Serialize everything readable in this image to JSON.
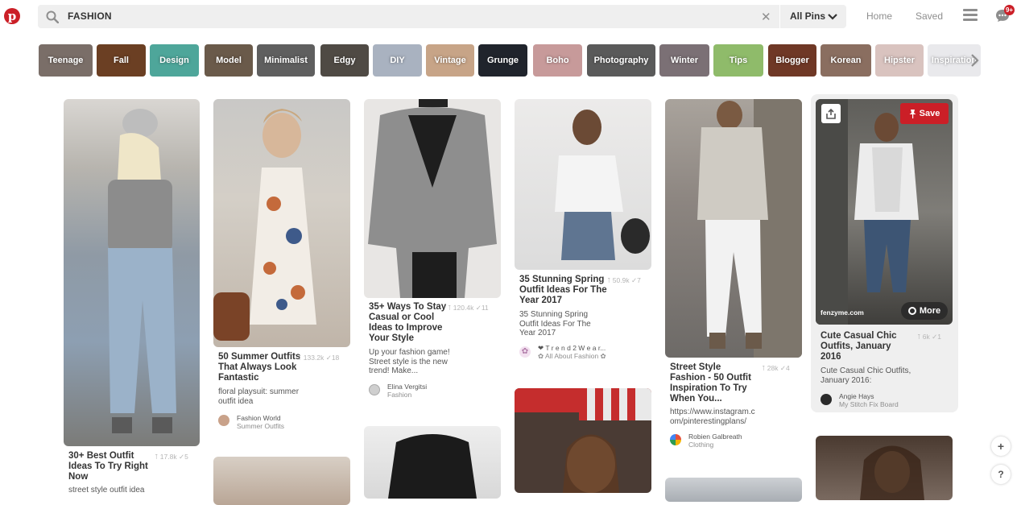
{
  "header": {
    "logo": "p",
    "search_value": "FASHION",
    "clear": "✕",
    "filter": "All Pins",
    "nav_home": "Home",
    "nav_saved": "Saved",
    "notifications_badge": "9+"
  },
  "guides": [
    {
      "label": "Teenage",
      "color": "#7a6e68"
    },
    {
      "label": "Fall",
      "color": "#6b3f23"
    },
    {
      "label": "Design",
      "color": "#4ea69a"
    },
    {
      "label": "Model",
      "color": "#6a5a4a"
    },
    {
      "label": "Minimalist",
      "color": "#5f5f5f"
    },
    {
      "label": "Edgy",
      "color": "#4f4a44"
    },
    {
      "label": "DIY",
      "color": "#a9b2c0"
    },
    {
      "label": "Vintage",
      "color": "#c7a487"
    },
    {
      "label": "Grunge",
      "color": "#20242c"
    },
    {
      "label": "Boho",
      "color": "#c79a9a"
    },
    {
      "label": "Photography",
      "color": "#5a5a5a"
    },
    {
      "label": "Winter",
      "color": "#7b7075"
    },
    {
      "label": "Tips",
      "color": "#8fbb6a"
    },
    {
      "label": "Blogger",
      "color": "#6f3826"
    },
    {
      "label": "Korean",
      "color": "#8a6e60"
    },
    {
      "label": "Hipster",
      "color": "#d9c3bf"
    },
    {
      "label": "Inspiration",
      "color": "#e9e9ec"
    }
  ],
  "pins": [
    {
      "title": "30+ Best Outfit Ideas To Try Right Now",
      "saves": "17.8k",
      "repins": "5",
      "description": "street style outfit idea"
    },
    {
      "title": "50 Summer Outfits That Always Look Fantastic",
      "saves": "133.2k",
      "repins": "18",
      "description": "floral playsuit: summer outfit idea",
      "user": "Fashion World",
      "board": "Summer Outfits"
    },
    {
      "title": "35+ Ways To Stay Casual or Cool Ideas to Improve Your Style",
      "saves": "120.4k",
      "repins": "11",
      "description": "Up your fashion game! Street style is the new trend! Make...",
      "user": "Elina Vergitsi",
      "board": "Fashion"
    },
    {
      "title": "35 Stunning Spring Outfit Ideas For The Year 2017",
      "saves": "50.9k",
      "repins": "7",
      "description": "35 Stunning Spring Outfit Ideas For The Year 2017",
      "user": "❤ T r e n d 2 W e a r...",
      "board": "✿ All About Fashion ✿"
    },
    {
      "title": "Street Style Fashion - 50 Outfit Inspiration To Try When You...",
      "saves": "28k",
      "repins": "4",
      "description": "https://www.instagram.com/pinterestingplans/",
      "user": "Robien Galbreath",
      "board": "Clothing"
    },
    {
      "title": "Cute Casual Chic Outfits, January 2016",
      "saves": "6k",
      "repins": "1",
      "description": "Cute Casual Chic Outfits, January 2016:",
      "user": "Angie Hays",
      "board": "My Stitch Fix Board",
      "source": "fenzyme.com",
      "save_label": "Save",
      "more_label": "More"
    }
  ],
  "fab_add": "+",
  "fab_help": "?"
}
